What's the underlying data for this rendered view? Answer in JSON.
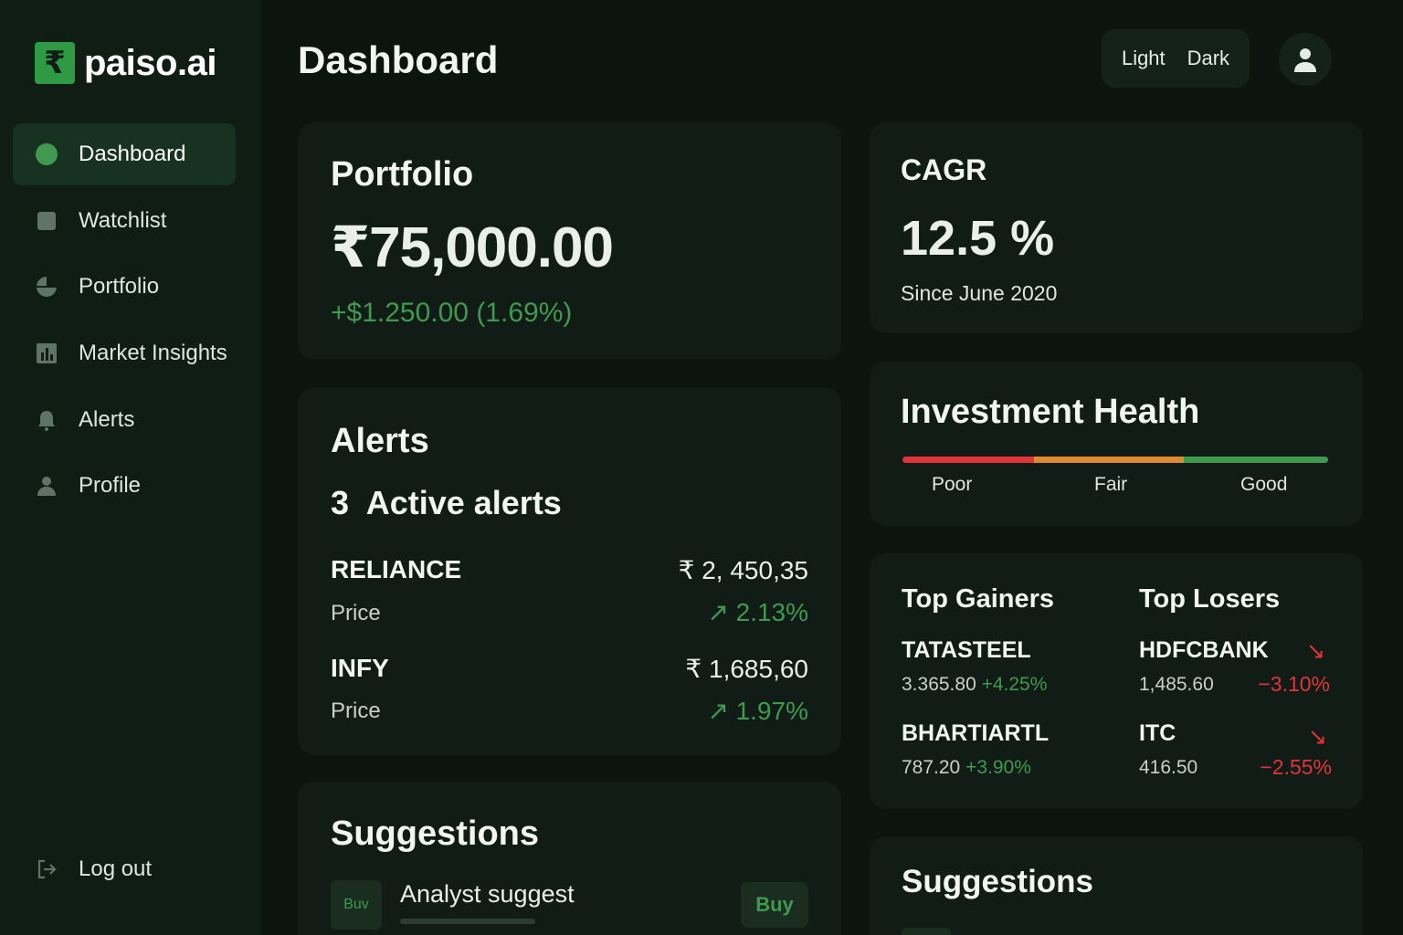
{
  "brand": {
    "logo_symbol": "₹",
    "name": "paiso.ai"
  },
  "sidebar": {
    "items": [
      {
        "label": "Dashboard",
        "icon": "dot-icon",
        "active": true
      },
      {
        "label": "Watchlist",
        "icon": "square-icon"
      },
      {
        "label": "Portfolio",
        "icon": "pie-chart-icon"
      },
      {
        "label": "Market Insights",
        "icon": "bar-chart-icon"
      },
      {
        "label": "Alerts",
        "icon": "bell-icon"
      },
      {
        "label": "Profile",
        "icon": "user-icon"
      }
    ],
    "logout": {
      "label": "Log out",
      "icon": "logout-icon"
    }
  },
  "header": {
    "title": "Dashboard",
    "theme_light": "Light",
    "theme_dark": "Dark",
    "avatar_icon": "user-icon"
  },
  "portfolio": {
    "title": "Portfolio",
    "value": "₹75,000.00",
    "change": "+$1.250.00 (1.69%)"
  },
  "alerts": {
    "title": "Alerts",
    "active_count": "3",
    "active_label": "Active alerts",
    "items": [
      {
        "symbol": "RELIANCE",
        "price_label": "Price",
        "price": "₹ 2, 450,35",
        "change": "2.13%",
        "arrow": "↗"
      },
      {
        "symbol": "INFY",
        "price_label": "Price",
        "price": "₹ 1,685,60",
        "change": "1.97%",
        "arrow": "↗"
      }
    ]
  },
  "suggestions_left": {
    "title": "Suggestions",
    "tag": "Buv",
    "text": "Analyst suggest",
    "button": "Buy"
  },
  "cagr": {
    "title": "CAGR",
    "value": "12.5 %",
    "since": "Since June 2020"
  },
  "health": {
    "title": "Investment Health",
    "labels": [
      "Poor",
      "Fair",
      "Good"
    ],
    "colors": [
      "#e0343a",
      "#e08a2e",
      "#3f9a4f"
    ]
  },
  "movers": {
    "gainers_title": "Top Gainers",
    "losers_title": "Top Losers",
    "gainers": [
      {
        "symbol": "TATASTEEL",
        "price": "3.365.80",
        "change": "+4.25%"
      },
      {
        "symbol": "BHARTIARTL",
        "price": "787.20",
        "change": "+3.90%"
      }
    ],
    "losers": [
      {
        "symbol": "HDFCBANK",
        "price": "1,485.60",
        "change": "−3.10%",
        "arrow": "↘"
      },
      {
        "symbol": "ITC",
        "price": "416.50",
        "change": "−2.55%",
        "arrow": "↘"
      }
    ]
  },
  "suggestions_right": {
    "title": "Suggestions"
  },
  "colors": {
    "accent": "#3f9a4f",
    "negative": "#e0343a",
    "background": "#0b140f",
    "sidebar": "#0f1d15",
    "card": "#121c16"
  }
}
